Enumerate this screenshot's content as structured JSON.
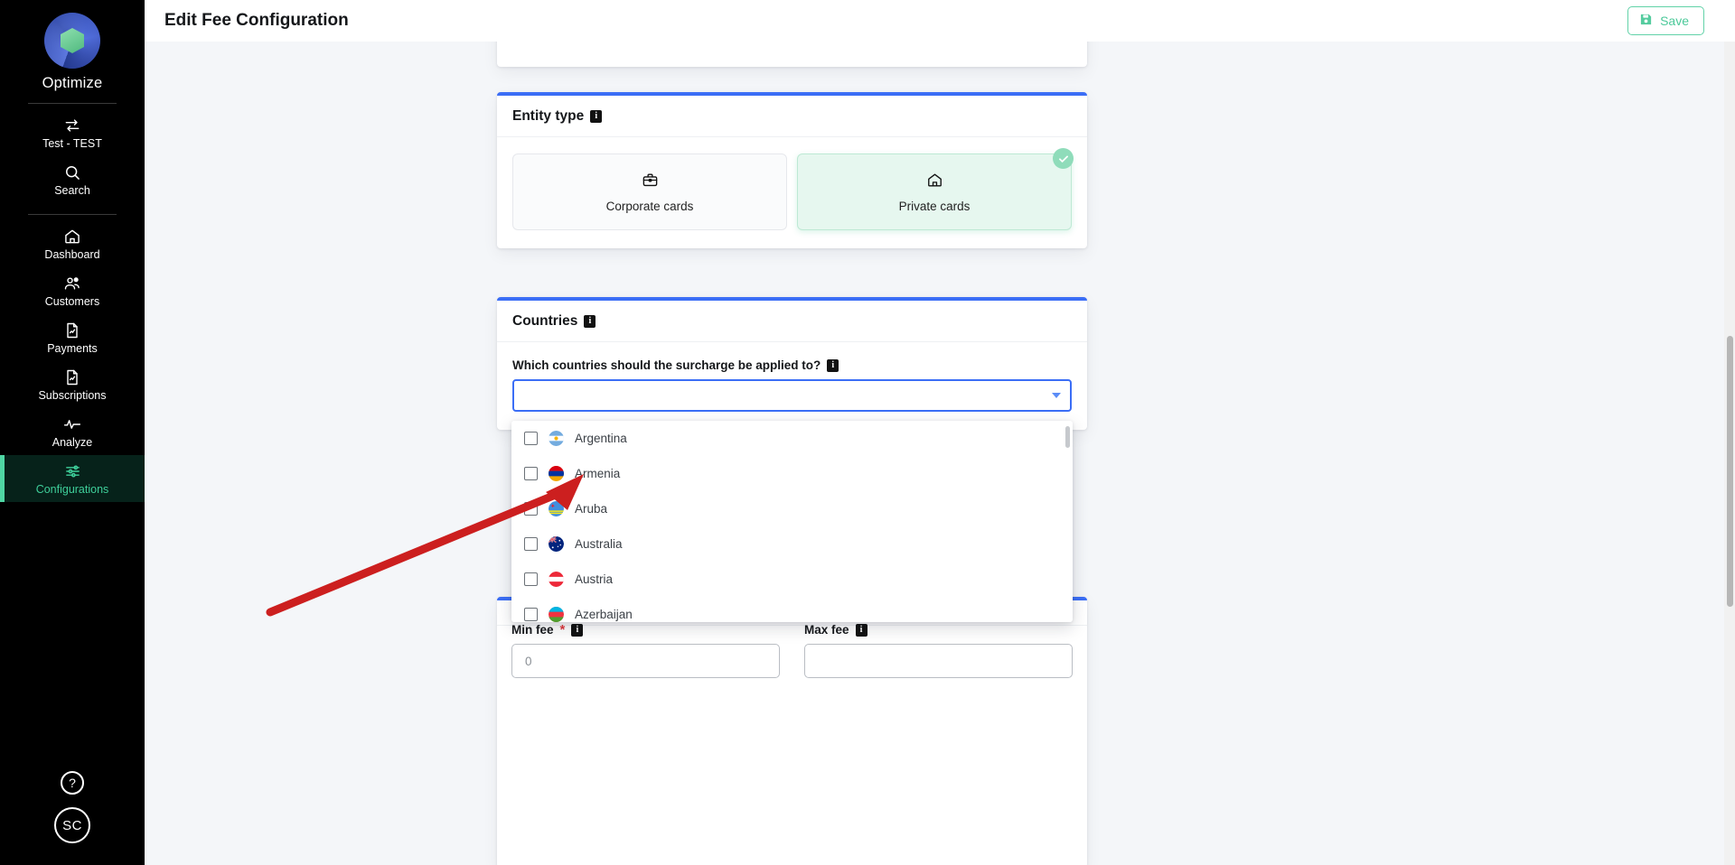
{
  "sidebar": {
    "brand": {
      "name": "Optimize",
      "logo_icon": "optimize-logo"
    },
    "items": [
      {
        "label": "Test - TEST",
        "icon": "swap-arrows-icon"
      },
      {
        "label": "Search",
        "icon": "search-icon"
      },
      {
        "label": "Dashboard",
        "icon": "home-icon"
      },
      {
        "label": "Customers",
        "icon": "users-icon"
      },
      {
        "label": "Payments",
        "icon": "document-icon"
      },
      {
        "label": "Subscriptions",
        "icon": "document-icon"
      },
      {
        "label": "Analyze",
        "icon": "pulse-icon"
      },
      {
        "label": "Configurations",
        "icon": "sliders-icon"
      }
    ],
    "active_item": "Configurations",
    "help_label": "?",
    "avatar_initials": "SC",
    "active_color": "#3ecf9a"
  },
  "topbar": {
    "title": "Edit Fee Configuration",
    "save_label": "Save",
    "save_icon": "save-floppy-icon",
    "accent_color": "#4cc99a"
  },
  "entity_card": {
    "title": "Entity type",
    "info_icon": "info-icon",
    "options": [
      {
        "label": "Corporate cards",
        "icon": "briefcase-icon",
        "selected": false
      },
      {
        "label": "Private cards",
        "icon": "home-icon",
        "selected": true
      }
    ],
    "selected_color": "#8fdcba"
  },
  "countries_card": {
    "title": "Countries",
    "info_icon": "info-icon",
    "question_label": "Which countries should the surcharge be applied to?",
    "select_value": "",
    "caret_icon": "chevron-down-icon",
    "focus_color": "#3b6ef6"
  },
  "dropdown": {
    "options": [
      {
        "label": "Argentina",
        "checked": false,
        "flag": "flag-ar"
      },
      {
        "label": "Armenia",
        "checked": false,
        "flag": "flag-am"
      },
      {
        "label": "Aruba",
        "checked": false,
        "flag": "flag-aw"
      },
      {
        "label": "Australia",
        "checked": false,
        "flag": "flag-au"
      },
      {
        "label": "Austria",
        "checked": false,
        "flag": "flag-at"
      },
      {
        "label": "Azerbaijan",
        "checked": false,
        "flag": "flag-az"
      }
    ]
  },
  "fees": {
    "min": {
      "label": "Min fee",
      "required": true,
      "required_mark": "*",
      "value": "",
      "placeholder": "0",
      "info_icon": "info-icon"
    },
    "max": {
      "label": "Max fee",
      "required": false,
      "value": "",
      "placeholder": "",
      "info_icon": "info-icon"
    }
  },
  "annotation": {
    "arrow_color": "#cc1f1f",
    "type": "arrow-pointer"
  }
}
